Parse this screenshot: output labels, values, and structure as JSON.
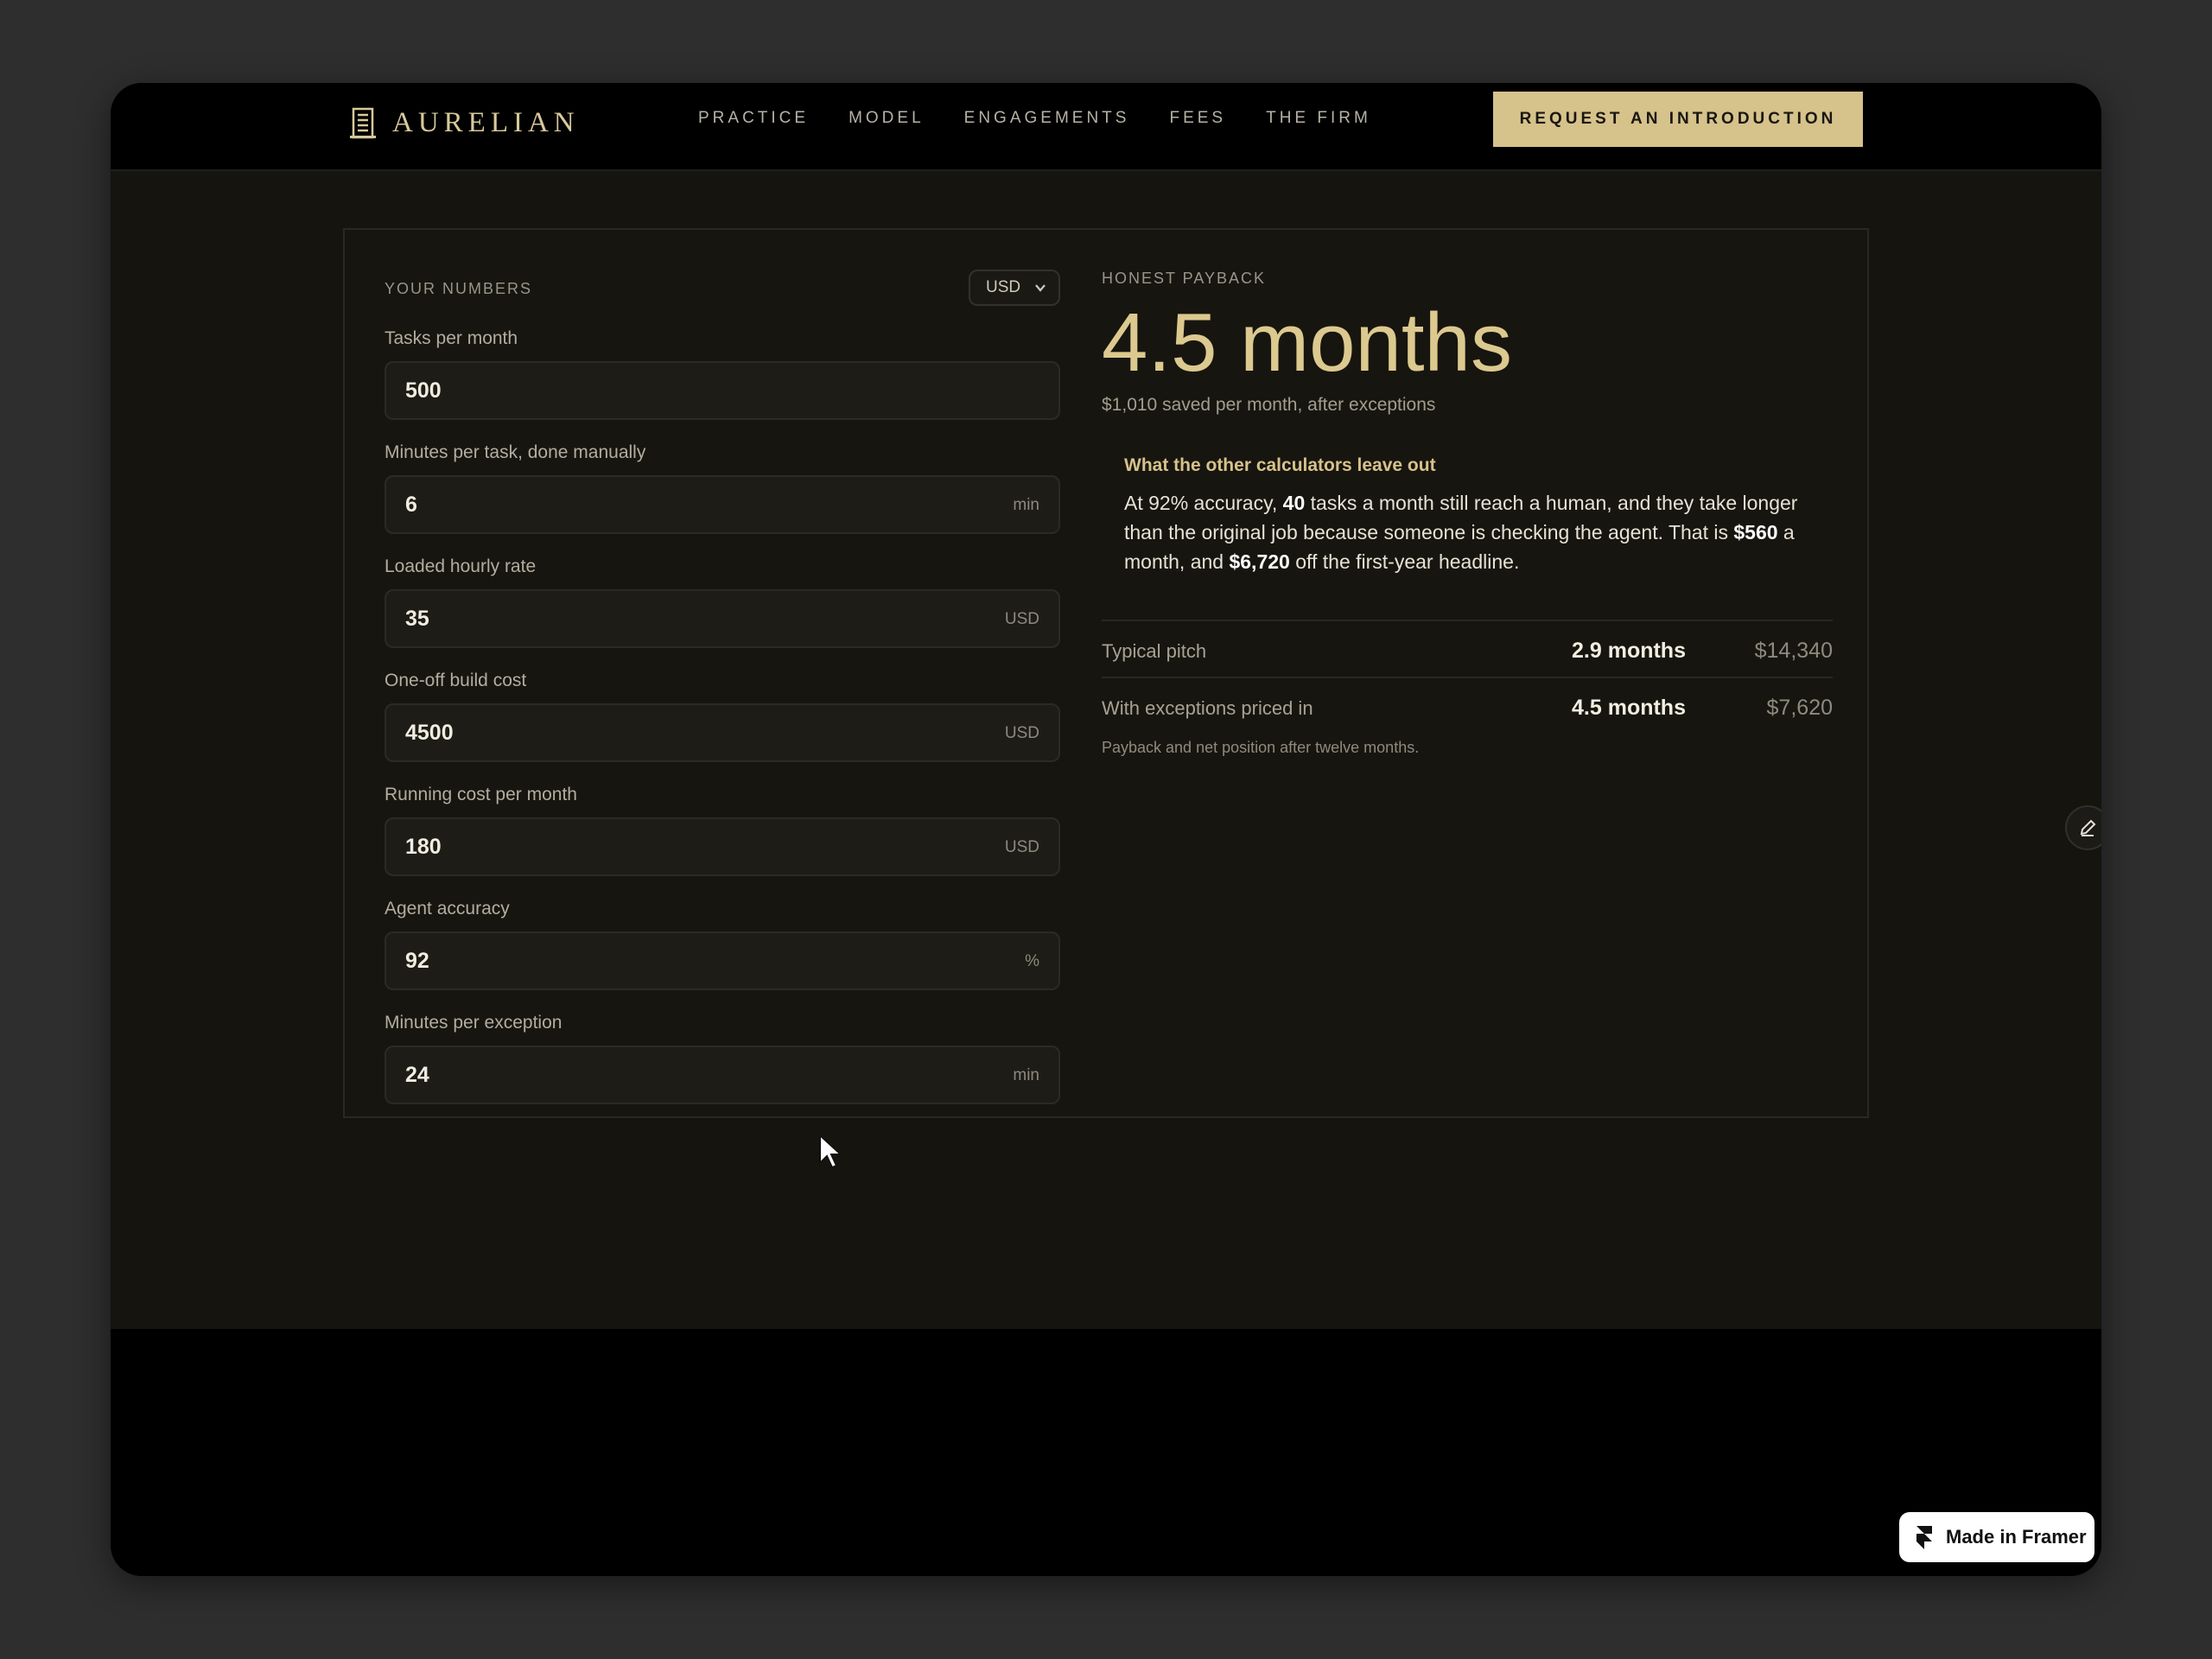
{
  "brand": {
    "name": "AURELIAN"
  },
  "nav": {
    "links": [
      "PRACTICE",
      "MODEL",
      "ENGAGEMENTS",
      "FEES",
      "THE FIRM"
    ],
    "cta_label": "REQUEST AN INTRODUCTION"
  },
  "calculator": {
    "heading": "YOUR NUMBERS",
    "currency": "USD",
    "fields": [
      {
        "label": "Tasks per month",
        "value": "500",
        "unit": ""
      },
      {
        "label": "Minutes per task, done manually",
        "value": "6",
        "unit": "min"
      },
      {
        "label": "Loaded hourly rate",
        "value": "35",
        "unit": "USD"
      },
      {
        "label": "One-off build cost",
        "value": "4500",
        "unit": "USD"
      },
      {
        "label": "Running cost per month",
        "value": "180",
        "unit": "USD"
      },
      {
        "label": "Agent accuracy",
        "value": "92",
        "unit": "%"
      },
      {
        "label": "Minutes per exception",
        "value": "24",
        "unit": "min"
      }
    ]
  },
  "result": {
    "label": "HONEST PAYBACK",
    "payback": "4.5 months",
    "subtext": "$1,010 saved per month, after exceptions",
    "callout": {
      "title": "What the other calculators leave out",
      "part1": "At 92% accuracy, ",
      "b1": "40",
      "part2": " tasks a month still reach a human, and they take longer than the original job because someone is checking the agent. That is ",
      "b2": "$560",
      "part3": " a month, and ",
      "b3": "$6,720",
      "part4": " off the first-year headline."
    },
    "comparison": [
      {
        "label": "Typical pitch",
        "months": "2.9 months",
        "value": "$14,340"
      },
      {
        "label": "With exceptions priced in",
        "months": "4.5 months",
        "value": "$7,620"
      }
    ],
    "note": "Payback and net position after twelve months."
  },
  "badge": {
    "label": "Made in Framer"
  },
  "colors": {
    "accent": "#d6c28b",
    "background": "#16140f",
    "page": "#2e2e2f"
  }
}
